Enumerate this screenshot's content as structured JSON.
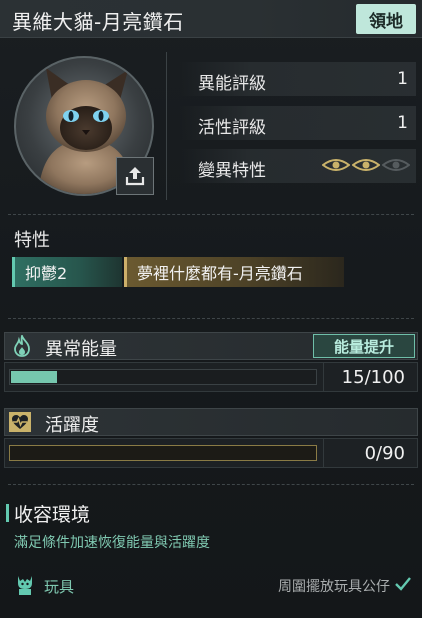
{
  "header": {
    "title": "異維大貓-月亮鑽石",
    "territory_button": "領地"
  },
  "stats": [
    {
      "label": "異能評級",
      "value": "1"
    },
    {
      "label": "活性評級",
      "value": "1"
    },
    {
      "label": "變異特性",
      "value": ""
    }
  ],
  "mutation": {
    "active_count": 2,
    "total": 3
  },
  "traits": {
    "heading": "特性",
    "tags": [
      "抑鬱2",
      "夢裡什麼都有-月亮鑽石"
    ]
  },
  "energy": {
    "title": "異常能量",
    "boost_label": "能量提升",
    "value_text": "15/100",
    "fraction": 0.15
  },
  "activity": {
    "title": "活躍度",
    "value_text": "0/90",
    "fraction": 0
  },
  "containment": {
    "title": "收容環境",
    "description": "滿足條件加速恢復能量與活躍度",
    "toy_label": "玩具",
    "toy_status": "周圍擺放玩具公仔"
  },
  "colors": {
    "accent_teal": "#76c7ae",
    "accent_gold": "#c9b26a",
    "territory_bg": "#bfe7db"
  },
  "icons": {
    "upload": "upload-icon",
    "energy": "flame-icon",
    "activity": "heart-pulse-icon",
    "toy": "toy-icon",
    "check": "check-icon",
    "mutation": "eye-icon"
  }
}
